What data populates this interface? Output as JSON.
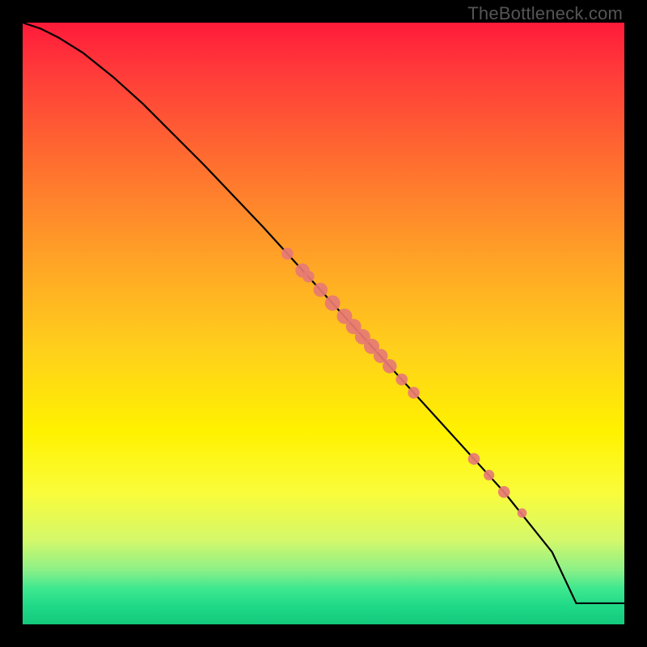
{
  "watermark": "TheBottleneck.com",
  "chart_data": {
    "type": "line",
    "title": "",
    "xlabel": "",
    "ylabel": "",
    "xlim": [
      0,
      100
    ],
    "ylim": [
      0,
      100
    ],
    "grid": false,
    "series": [
      {
        "name": "curve",
        "x": [
          0,
          3,
          6,
          10,
          15,
          20,
          30,
          40,
          50,
          60,
          70,
          80,
          88,
          92,
          100
        ],
        "y": [
          100,
          99,
          97.5,
          95,
          91,
          86.5,
          76.5,
          66,
          55,
          44,
          33,
          22,
          12,
          3.5,
          3.5
        ]
      }
    ],
    "points": [
      {
        "x": 44.0,
        "y": 61.6,
        "r": 1.0
      },
      {
        "x": 46.5,
        "y": 58.8,
        "r": 1.2
      },
      {
        "x": 47.5,
        "y": 57.8,
        "r": 1.0
      },
      {
        "x": 49.5,
        "y": 55.6,
        "r": 1.2
      },
      {
        "x": 51.5,
        "y": 53.4,
        "r": 1.3
      },
      {
        "x": 53.5,
        "y": 51.2,
        "r": 1.3
      },
      {
        "x": 55.0,
        "y": 49.5,
        "r": 1.3
      },
      {
        "x": 56.5,
        "y": 47.8,
        "r": 1.3
      },
      {
        "x": 58.0,
        "y": 46.2,
        "r": 1.3
      },
      {
        "x": 59.5,
        "y": 44.6,
        "r": 1.2
      },
      {
        "x": 61.0,
        "y": 42.9,
        "r": 1.2
      },
      {
        "x": 63.0,
        "y": 40.7,
        "r": 1.0
      },
      {
        "x": 65.0,
        "y": 38.5,
        "r": 1.0
      },
      {
        "x": 75.0,
        "y": 27.5,
        "r": 1.0
      },
      {
        "x": 77.5,
        "y": 24.8,
        "r": 0.9
      },
      {
        "x": 80.0,
        "y": 22.0,
        "r": 1.0
      },
      {
        "x": 83.0,
        "y": 18.5,
        "r": 0.8
      }
    ],
    "point_color": "#e77a74",
    "line_color": "#000000"
  }
}
